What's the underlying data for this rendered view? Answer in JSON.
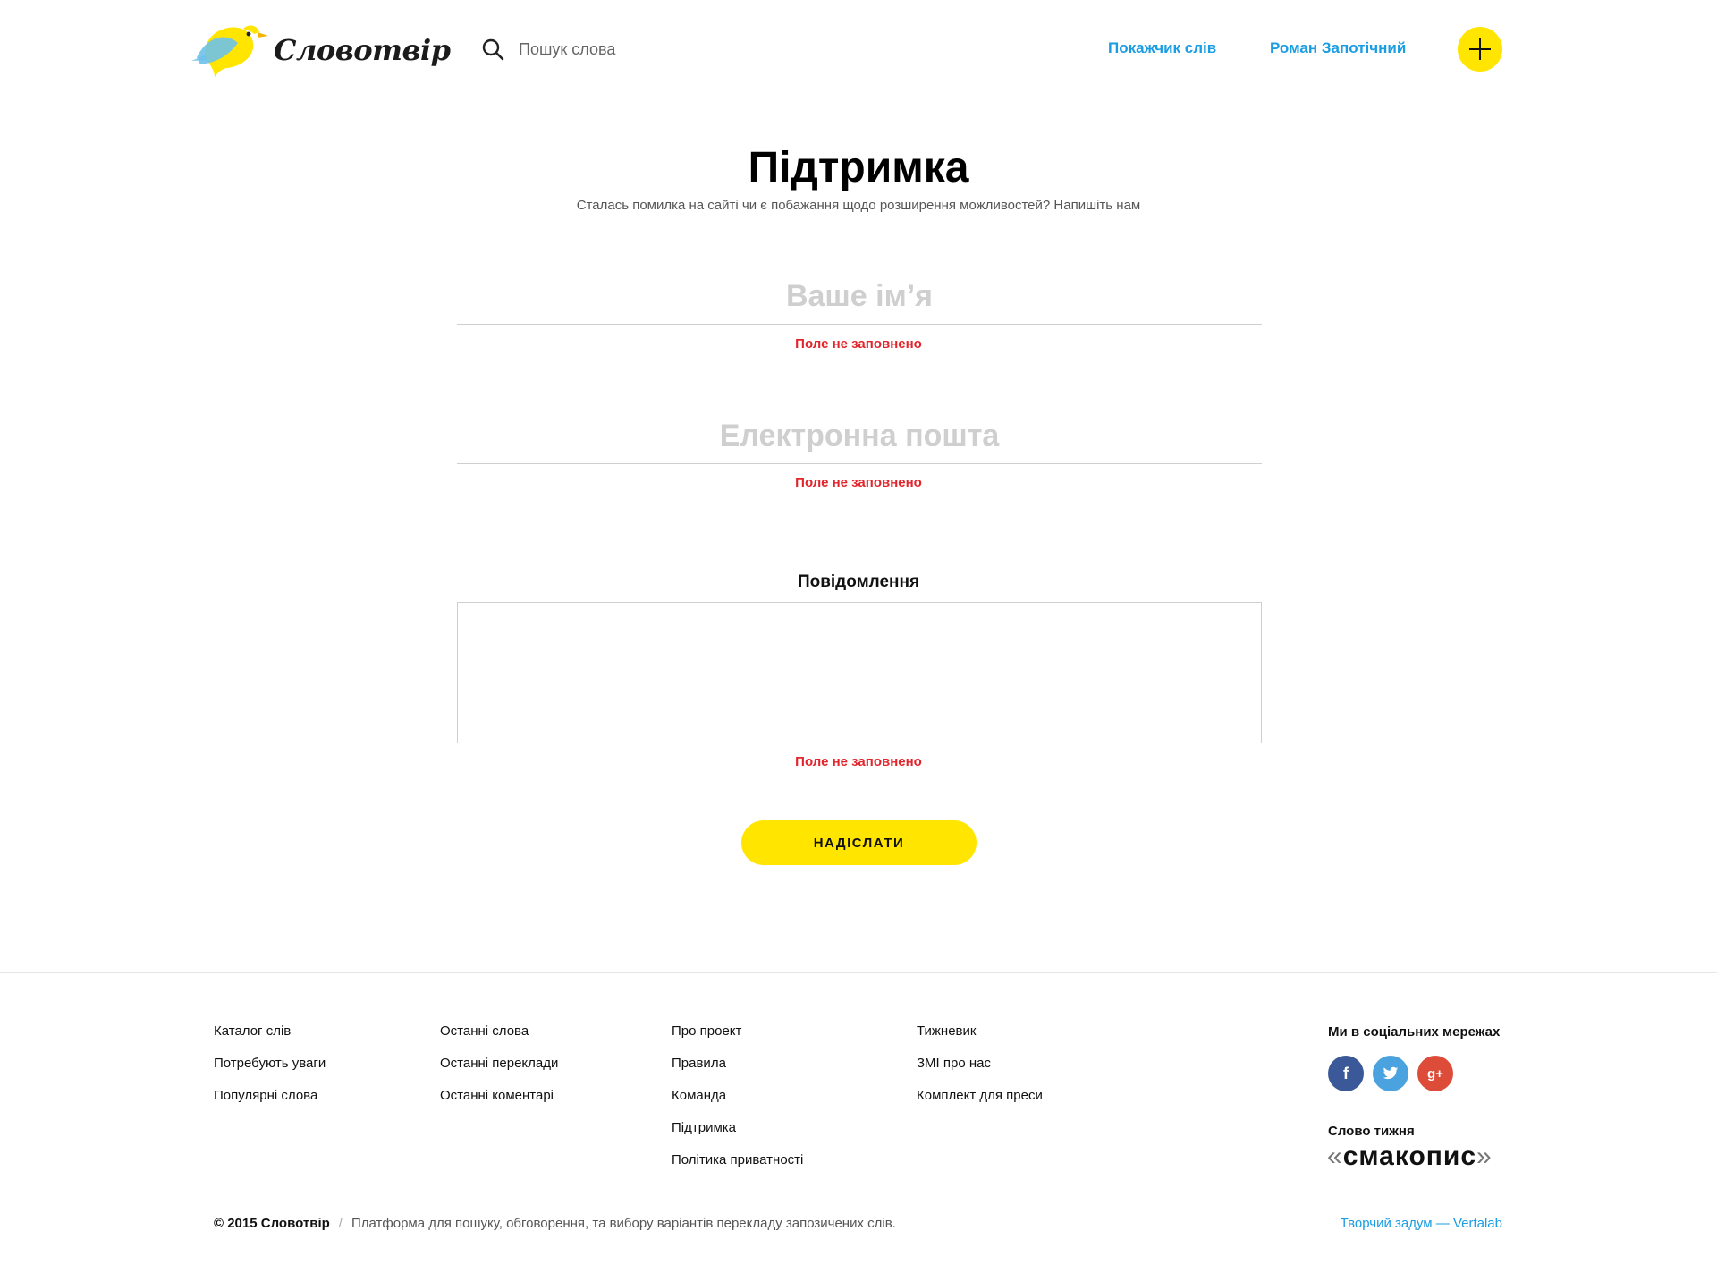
{
  "header": {
    "logo_text": "Словотвір",
    "search_placeholder": "Пошук слова",
    "nav_index": "Покажчик слів",
    "nav_user": "Роман Запотічний"
  },
  "main": {
    "title": "Підтримка",
    "subtitle": "Сталась помилка на сайті чи є побажання щодо розширення можливостей? Напишіть нам",
    "name_placeholder": "Ваше ім’я",
    "email_placeholder": "Електронна пошта",
    "error_text": "Поле не заповнено",
    "message_label": "Повідомлення",
    "submit_label": "НАДІСЛАТИ"
  },
  "footer": {
    "col1": [
      "Каталог слів",
      "Потребують уваги",
      "Популярні слова"
    ],
    "col2": [
      "Останні слова",
      "Останні переклади",
      "Останні коментарі"
    ],
    "col3": [
      "Про проект",
      "Правила",
      "Команда",
      "Підтримка",
      "Політика приватності"
    ],
    "col4": [
      "Тижневик",
      "ЗМІ про нас",
      "Комплект для преси"
    ],
    "social_title": "Ми в соціальних мережах",
    "social_icons": [
      "facebook-icon",
      "twitter-icon",
      "google-plus-icon"
    ],
    "word_title": "Слово тижня",
    "word_of_week": "смакопис",
    "copyright_year": "© 2015 Словотвір",
    "copyright_desc": "Платформа для пошуку, обговорення, та вибору варіантів перекладу запозичених слів.",
    "credit": "Творчий задум — Vertalab"
  },
  "colors": {
    "accent_yellow": "#ffe500",
    "link_blue": "#1a9de3",
    "error_red": "#e3242b"
  }
}
